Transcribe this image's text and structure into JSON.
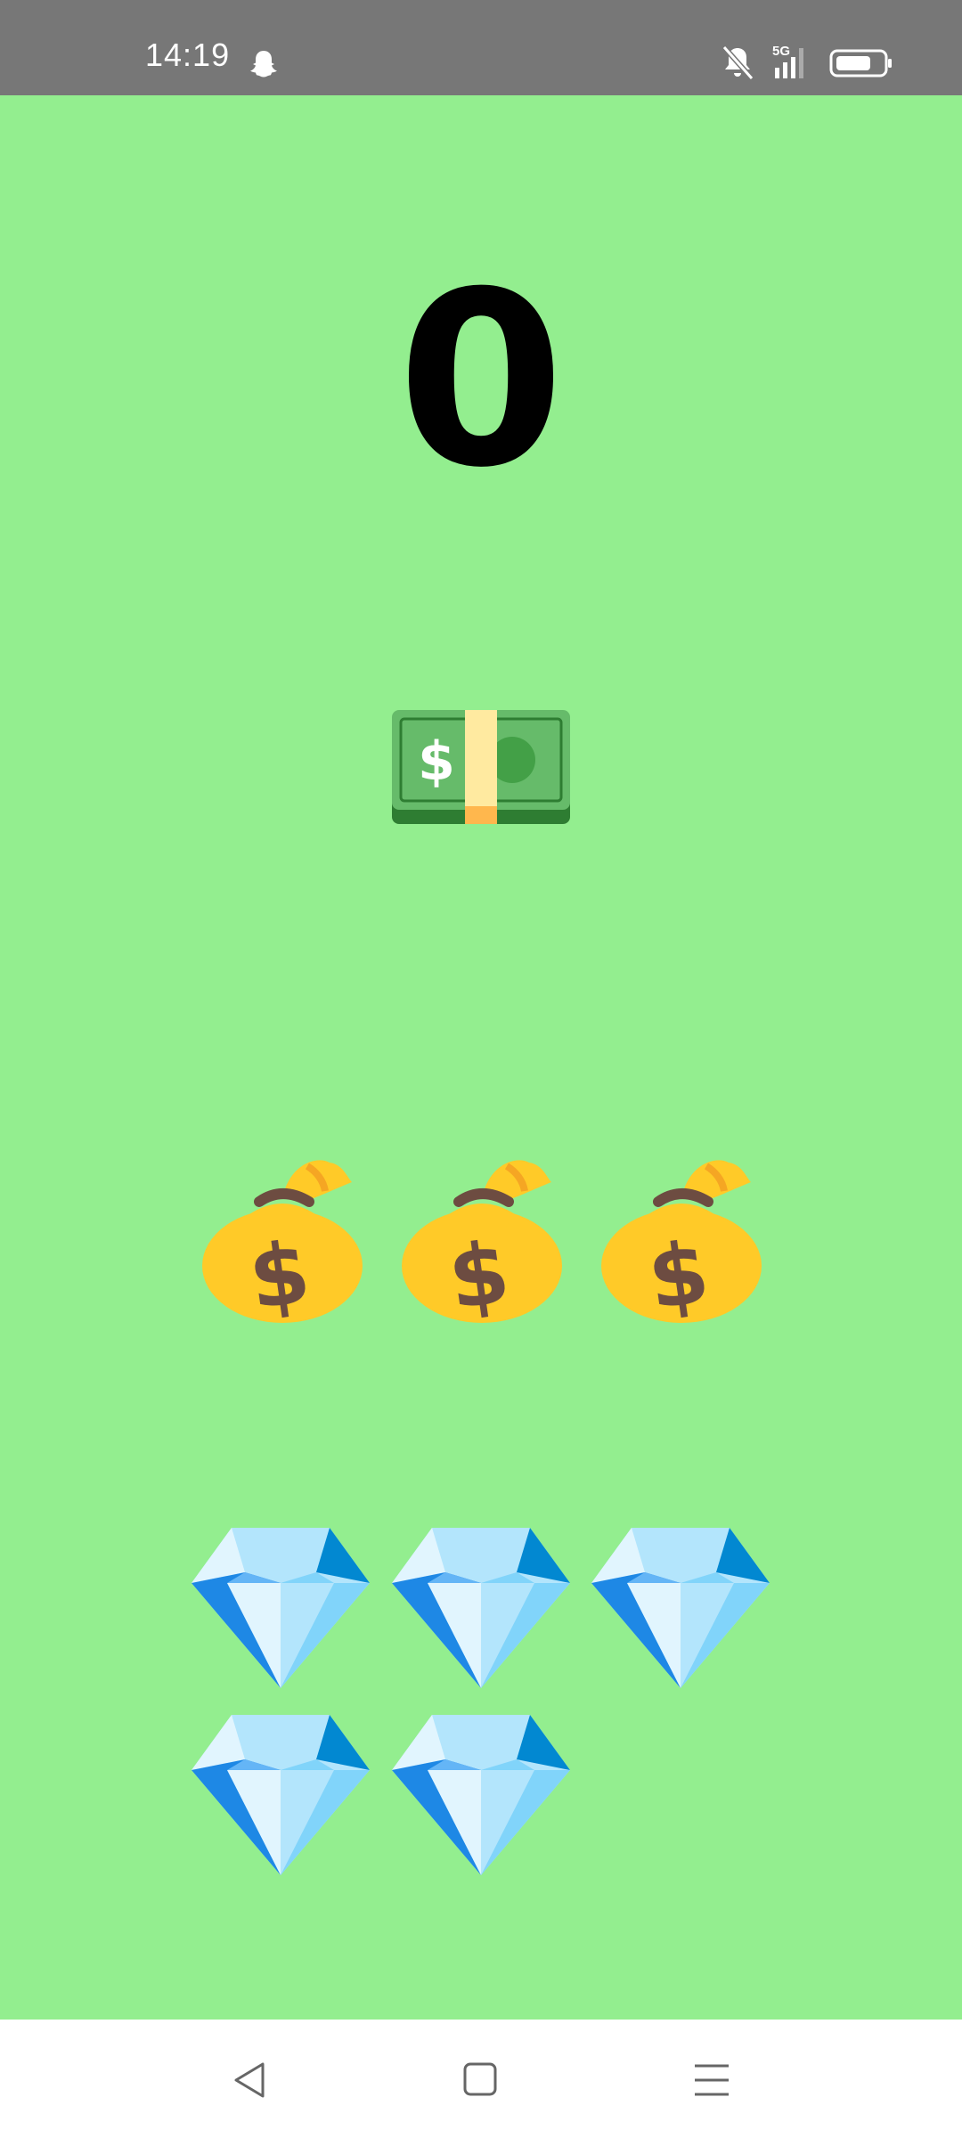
{
  "status_bar": {
    "time": "14:19",
    "network": "5G",
    "icons": [
      "snapchat-ghost-icon",
      "bell-muted-icon",
      "signal-5g-icon",
      "battery-icon"
    ]
  },
  "main": {
    "score": "0",
    "background_color": "#93ee8f",
    "items": {
      "banknote": {
        "icon": "dollar-banknote-icon",
        "count": 1
      },
      "money_bags": {
        "icon": "money-bag-icon",
        "count": 3
      },
      "gems": {
        "icon": "gem-stone-icon",
        "count": 5
      }
    }
  },
  "nav_bar": {
    "buttons": [
      "back-icon",
      "home-icon",
      "recents-menu-icon"
    ]
  }
}
